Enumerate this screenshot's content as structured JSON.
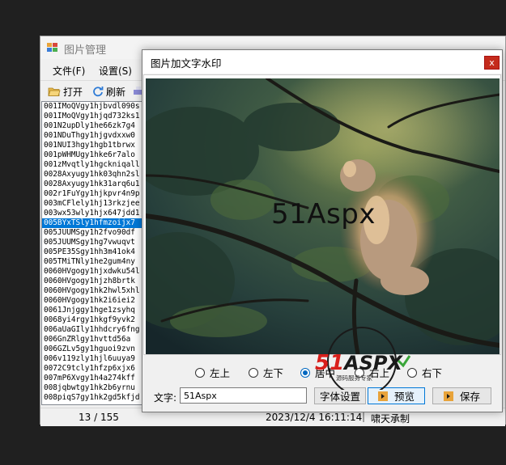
{
  "main_window": {
    "title": "图片管理",
    "menu": [
      "文件(F)",
      "设置(S)"
    ],
    "toolbar": {
      "open_label": "打开",
      "refresh_label": "刷新"
    },
    "file_list": {
      "selected_index": 13,
      "items": [
        "001IMoQVgy1hjbvdl090s",
        "001IMoQVgy1hjqd732ks1",
        "001N2upDly1he66zk7g4",
        "001NDuThgy1hjgvdxxw0",
        "001NUI3hgy1hgb1tbrwx",
        "001pWHMUgy1hke6r7alo",
        "001zMvqtly1hgckniqall",
        "0028Axyugy1hk03qhn2sl",
        "0028Axyugy1hk31arq6u1",
        "002r1FuYgy1hjkpvr4n9p",
        "003mCFlely1hj13rkzjee",
        "003wx53wly1hjx647jdd1",
        "005BYxTSly1hfmzoijx7",
        "005JUUMSgy1h2fvo90df",
        "005JUUMSgy1hg7vwuqvt",
        "005PE35Sgy1hh3m41ok4",
        "005TMiTNly1he2gum4ny",
        "0060HVgogy1hjxdwku54l",
        "0060HVgogy1hjzh8brtk",
        "0060HVgogy1hk2hwl5xhl",
        "0060HVgogy1hk2i6iei2",
        "0061Jnjggy1hge1zsyhq",
        "0068yi4rgy1hkgf9yvk2",
        "006aUaGIly1hhdcry6fng",
        "006GnZRlgy1hvttd56a",
        "006GZLv5gy1hguoi9zvn",
        "006v119zly1hjl6uuya9",
        "0072C9tcly1hfzp6xjx6",
        "007mP6Xvgy1h4a274kff",
        "008jqbwtgy1hk2b6yrnu",
        "008piqS7gy1hk2gd5kfjd"
      ]
    },
    "status": {
      "counter": "13 / 155",
      "time": "2023/12/4 16:11:14",
      "separator": "|",
      "author": "啸天承制"
    }
  },
  "dialog": {
    "title": "图片加文字水印",
    "close_label": "x",
    "watermark_text": "51Aspx",
    "positions": [
      {
        "label": "左上",
        "checked": false
      },
      {
        "label": "左下",
        "checked": false
      },
      {
        "label": "居中",
        "checked": true
      },
      {
        "label": "右上",
        "checked": false
      },
      {
        "label": "右下",
        "checked": false
      }
    ],
    "text_label": "文字:",
    "text_value": "51Aspx",
    "font_button": "字体设置",
    "preview_button": "预览",
    "save_button": "保存",
    "logo": {
      "text": "51ASPX",
      "subtext": "源码服务专家"
    }
  },
  "colors": {
    "accent": "#0078d7",
    "close": "#c42b1c",
    "logo_red": "#d9201c",
    "logo_green": "#3aa63a"
  }
}
